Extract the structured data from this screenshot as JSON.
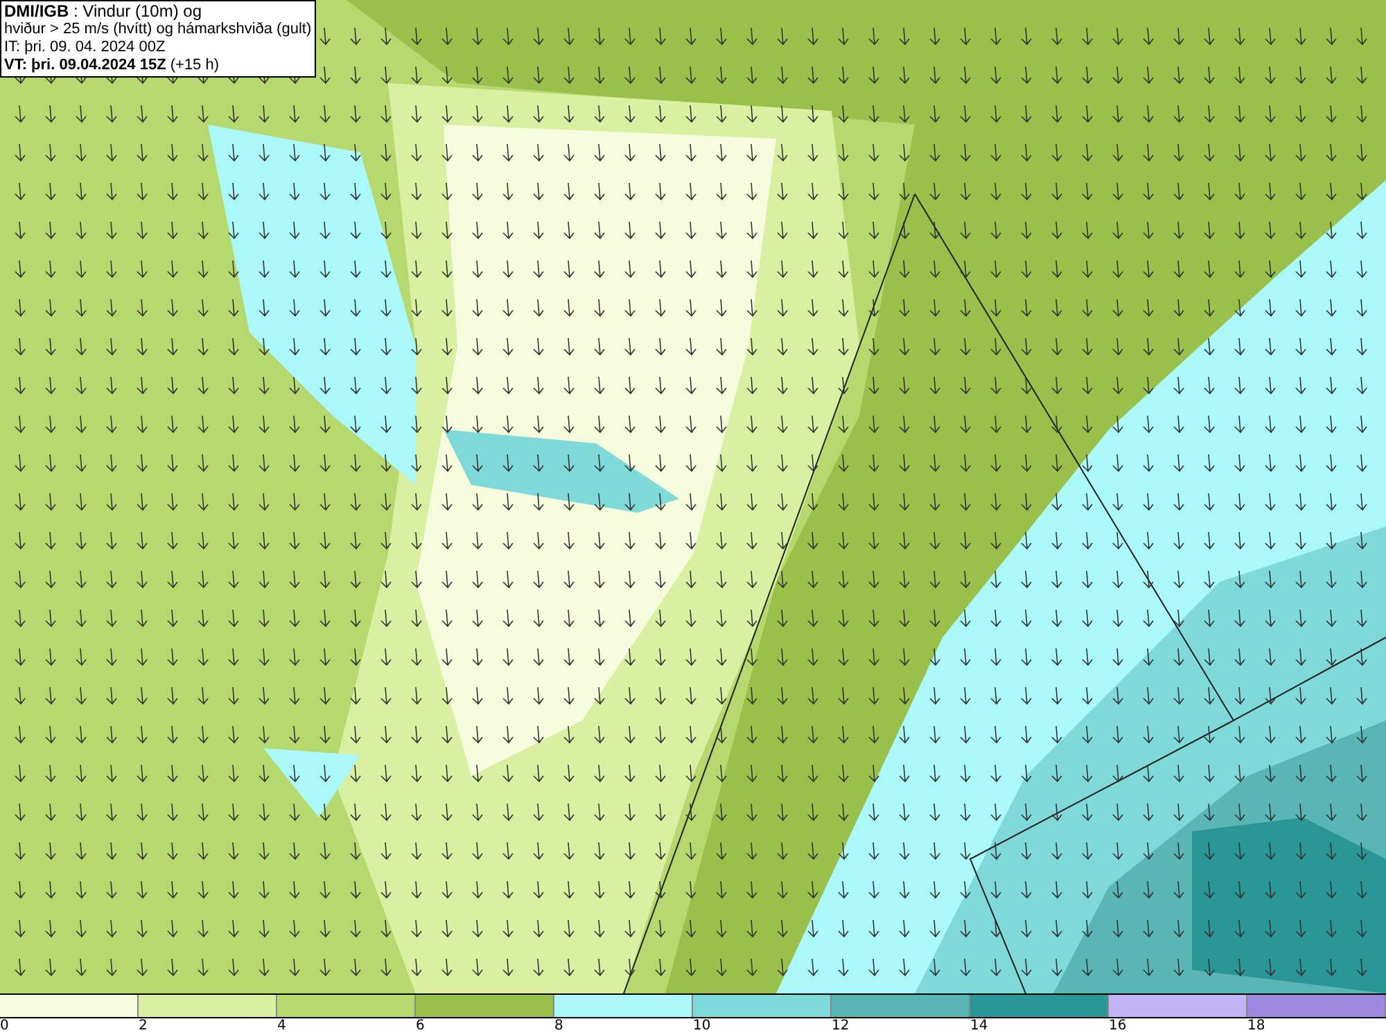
{
  "header": {
    "lines": [
      "**DMI/IGB** : Vindur (10m) og",
      "hviður > 25 m/s (hvítt) og hámarkshviða (gult)",
      "IT: þri. 09. 04. 2024 00Z",
      "**VT: þri. 09.04.2024 15Z** (+15 h)"
    ]
  },
  "legend": {
    "bins": [
      {
        "label": "0",
        "color": "#f5fbdc"
      },
      {
        "label": "2",
        "color": "#d9f0a3"
      },
      {
        "label": "4",
        "color": "#b5d96e"
      },
      {
        "label": "6",
        "color": "#98c04a"
      },
      {
        "label": "8",
        "color": "#aaf8fa"
      },
      {
        "label": "10",
        "color": "#7fd9d9"
      },
      {
        "label": "12",
        "color": "#5ab5b5"
      },
      {
        "label": "14",
        "color": "#2a9696"
      },
      {
        "label": "16",
        "color": "#c3b4f5"
      },
      {
        "label": "18",
        "color": "#9f88e0"
      }
    ]
  }
}
